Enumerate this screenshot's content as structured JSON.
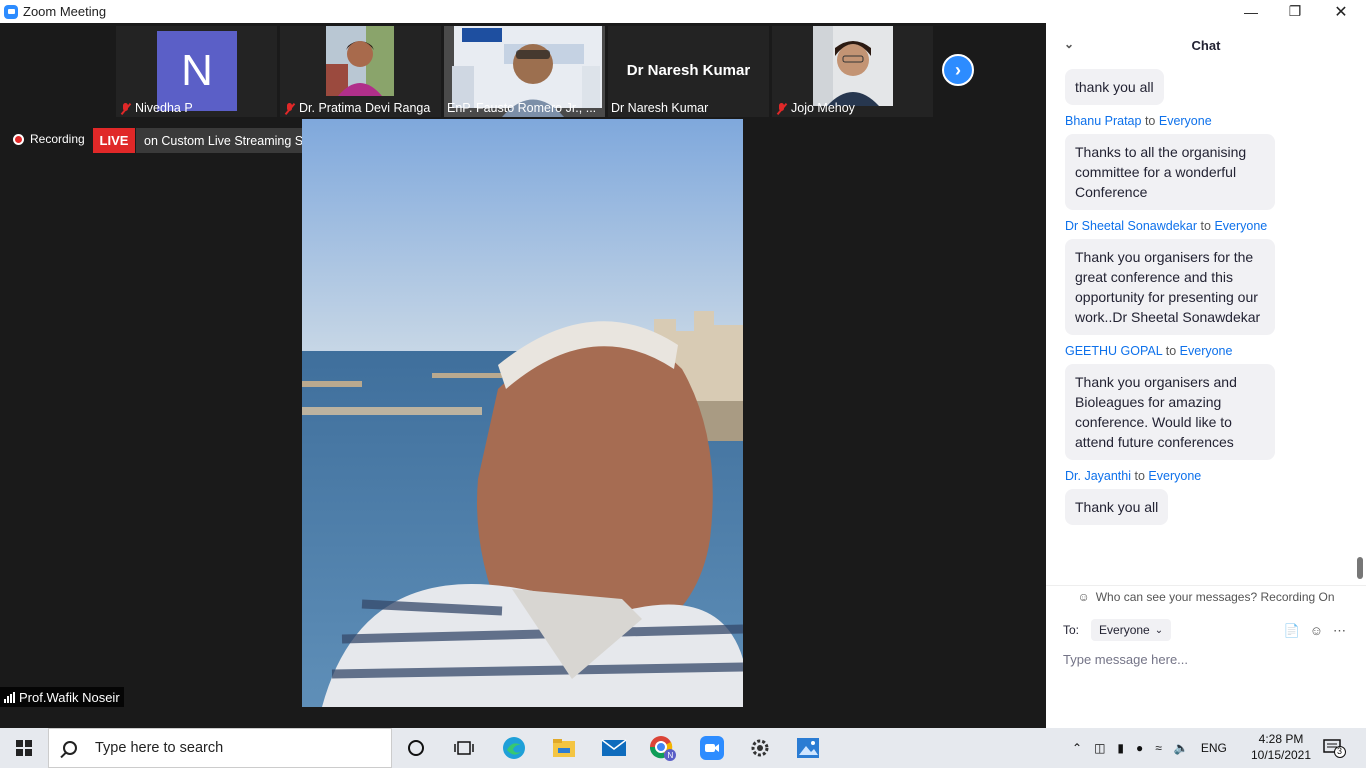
{
  "window": {
    "title": "Zoom Meeting"
  },
  "participants": [
    {
      "name": "Nivedha P",
      "initial": "N",
      "type": "avatar"
    },
    {
      "name": "Dr. Pratima Devi Ranga",
      "type": "video"
    },
    {
      "name": "EnP. Fausto Romero Jr., ...",
      "type": "video"
    },
    {
      "name": "Dr Naresh Kumar",
      "display": "Dr Naresh Kumar",
      "type": "name"
    },
    {
      "name": "Jojo Mehoy",
      "type": "video"
    }
  ],
  "recording": {
    "label": "Recording",
    "live_badge": "LIVE",
    "service": "on Custom Live Streaming Service"
  },
  "speaker": {
    "name": "Prof.Wafik Noseir"
  },
  "chat": {
    "title": "Chat",
    "to_label": "to",
    "messages": [
      {
        "sender": "",
        "recipient": "",
        "text": "thank you all"
      },
      {
        "sender": "Bhanu Pratap",
        "recipient": "Everyone",
        "text": "Thanks to all the organising committee for a wonderful Conference"
      },
      {
        "sender": "Dr Sheetal Sonawdekar",
        "recipient": "Everyone",
        "text": "Thank you organisers for the great conference and this opportunity for presenting our work..Dr Sheetal Sonawdekar"
      },
      {
        "sender": "GEETHU GOPAL",
        "recipient": "Everyone",
        "text": "Thank you organisers and Bioleagues for amazing conference. Would like to attend future conferences"
      },
      {
        "sender": "Dr. Jayanthi",
        "recipient": "Everyone",
        "text": "Thank you all"
      }
    ],
    "privacy_note": "Who can see your messages? Recording On",
    "to_field_label": "To:",
    "to_value": "Everyone",
    "input_placeholder": "Type message here..."
  },
  "taskbar": {
    "search_placeholder": "Type here to search",
    "language": "ENG",
    "time": "4:28 PM",
    "date": "10/15/2021",
    "notifications": "3"
  },
  "colors": {
    "accent": "#2d8cff",
    "live": "#e02828",
    "chat_sender": "#0e71eb"
  }
}
